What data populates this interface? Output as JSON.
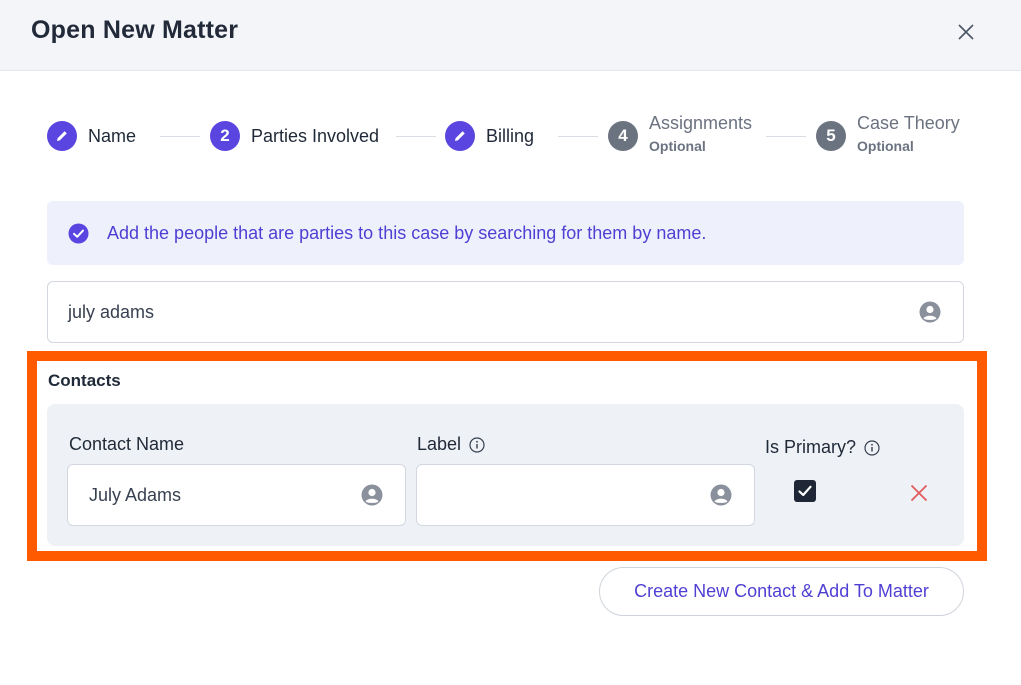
{
  "header": {
    "title": "Open New Matter"
  },
  "steps": [
    {
      "label": "Name",
      "icon": "pencil-icon",
      "state": "completed"
    },
    {
      "label": "Parties Involved",
      "number": "2",
      "state": "active"
    },
    {
      "label": "Billing",
      "icon": "pencil-icon",
      "state": "completed"
    },
    {
      "label": "Assignments",
      "number": "4",
      "sub": "Optional",
      "state": "pending"
    },
    {
      "label": "Case Theory",
      "number": "5",
      "sub": "Optional",
      "state": "pending"
    }
  ],
  "info": {
    "text": "Add the people that are parties to this case by searching for them by name.",
    "icon": "check-circle-icon"
  },
  "search": {
    "value": "july adams",
    "icon": "person-icon"
  },
  "contacts": {
    "title": "Contacts",
    "columns": {
      "name": "Contact Name",
      "label": "Label",
      "primary": "Is Primary?"
    },
    "row": {
      "name": "July Adams",
      "label": "",
      "is_primary": true
    }
  },
  "actions": {
    "create_label": "Create New Contact & Add To Matter"
  },
  "colors": {
    "accent": "#5b45e0",
    "highlight": "#ff5a00",
    "danger": "#e25c5c"
  }
}
